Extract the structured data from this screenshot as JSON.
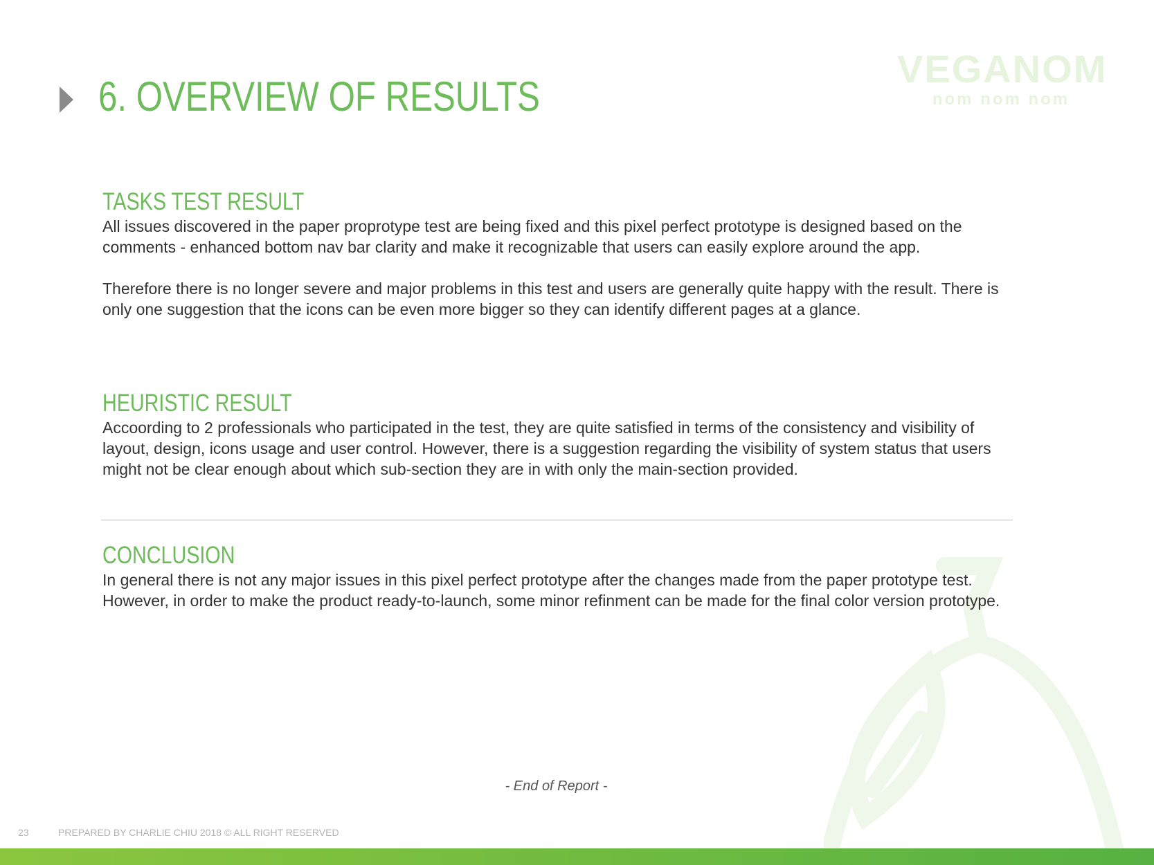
{
  "logo": {
    "main": "VEGANOM",
    "sub": "nom nom nom"
  },
  "page": {
    "title": "6. OVERVIEW OF RESULTS"
  },
  "tasks": {
    "heading": "TASKS TEST RESULT",
    "paragraph1": "All issues discovered in the paper proprotype test are being fixed and this pixel perfect prototype is designed based on the comments - enhanced bottom nav bar clarity and make it recognizable that users can easily explore around the app.",
    "paragraph2": "Therefore there is no longer severe and major problems in this test and users are generally quite happy with the result. There is only one suggestion that the icons can be even more bigger so they can identify different pages at a glance."
  },
  "heuristic": {
    "heading": "HEURISTIC RESULT",
    "paragraph": "Accoording to 2 professionals who participated in the test, they are quite satisfied in terms of the consistency and visibility of layout, design, icons usage and user control. However, there is a suggestion regarding the visibility of system  status that users might not be clear enough about which sub-section they are in with only the main-section provided."
  },
  "conclusion": {
    "heading": "CONCLUSION",
    "paragraph": "In general there is not any major issues in this pixel perfect prototype after the changes made from the paper prototype test. However, in order to make the product ready-to-launch, some minor refinment can be made for the final color version prototype."
  },
  "end_note": "-  End of Report  -",
  "footer": {
    "page_number": "23",
    "text": "PREPARED BY CHARLIE CHIU 2018  © ALL RIGHT RESERVED"
  },
  "colors": {
    "accent_green": "#6dbb5a",
    "body_text": "#333333",
    "bar_green": "#8cc63f"
  }
}
